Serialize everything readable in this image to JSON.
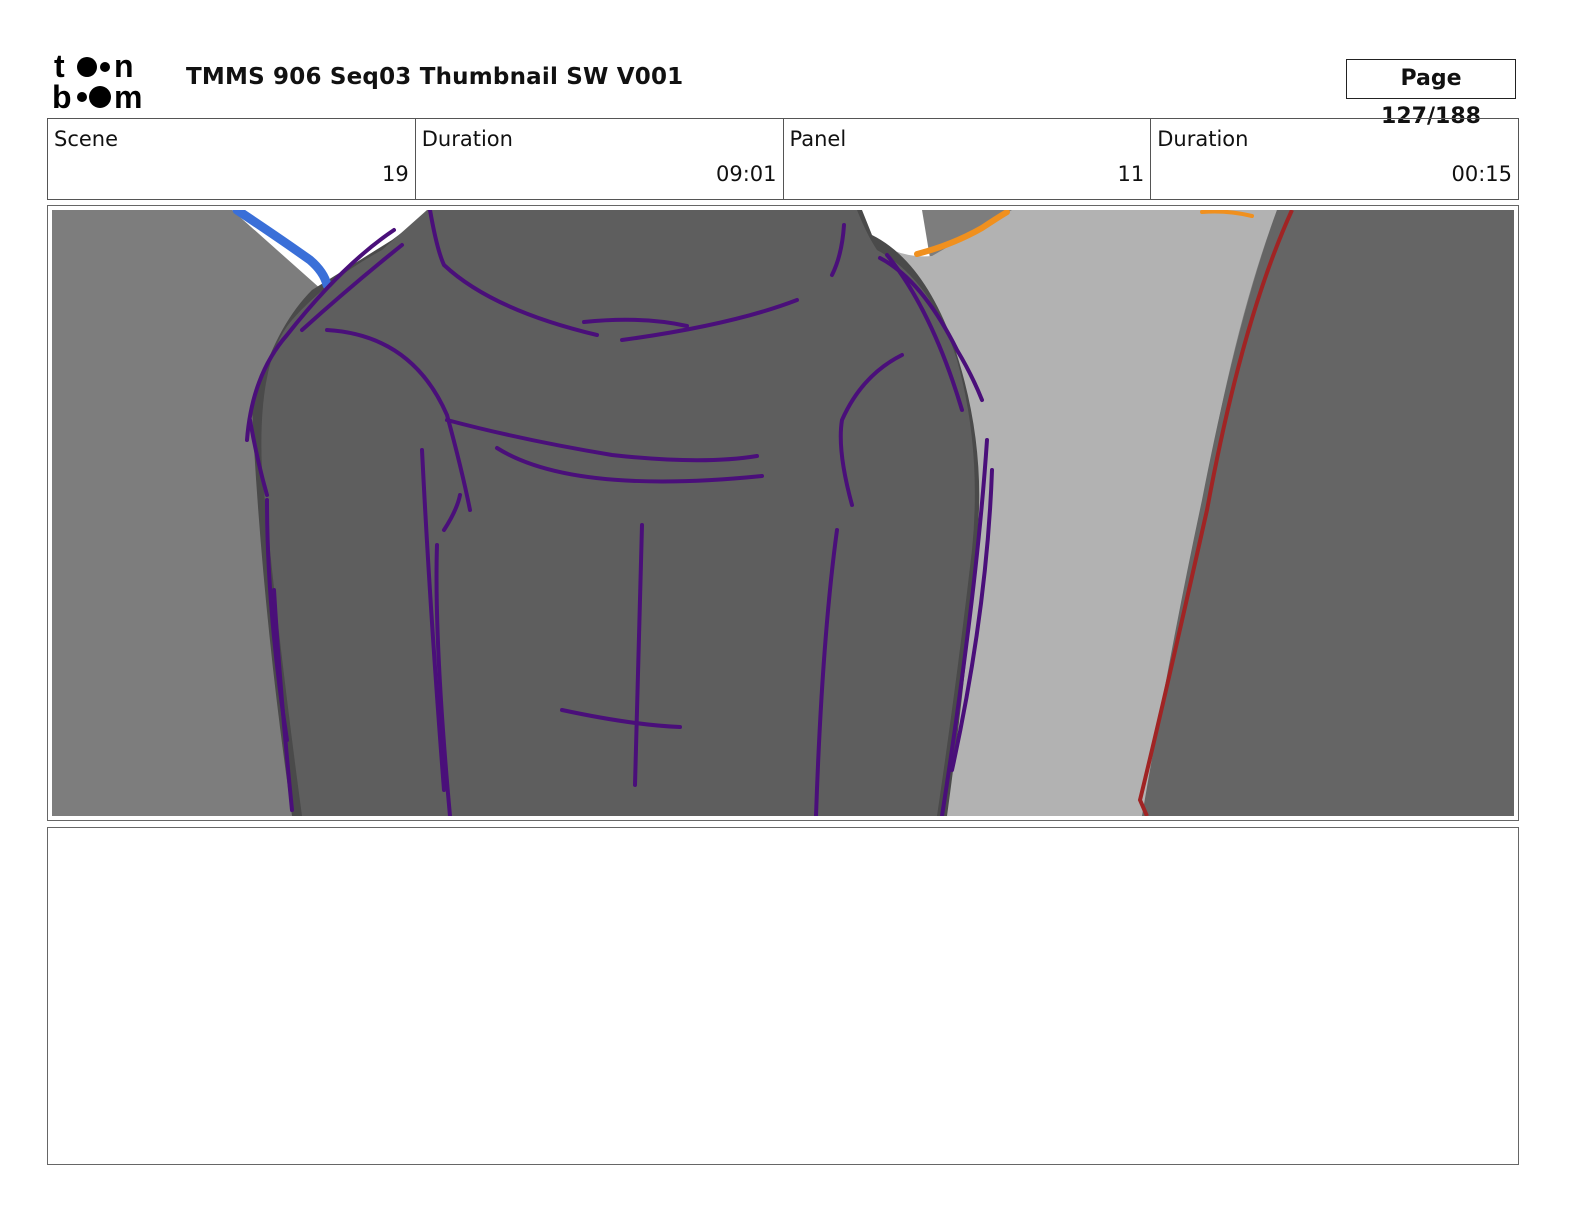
{
  "header": {
    "logo": {
      "brand": "toonboom",
      "line1": "t",
      "line1_end": "n",
      "line2": "b",
      "line2_end": "m"
    },
    "title": "TMMS 906 Seq03 Thumbnail SW V001",
    "page_label": "Page 127/188"
  },
  "info": {
    "scene_label": "Scene",
    "scene_value": "19",
    "scene_duration_label": "Duration",
    "scene_duration_value": "09:01",
    "panel_label": "Panel",
    "panel_value": "11",
    "panel_duration_label": "Duration",
    "panel_duration_value": "00:15"
  },
  "panel": {
    "colors": {
      "left_wall": "#7d7d7d",
      "right_wall": "#656565",
      "center_light": "#b2b2b2",
      "figure": "#5e5e5e",
      "figure_shadow": "#4a4a4a",
      "purple_line": "#4a0f7a",
      "red_line": "#a02424",
      "blue_accent": "#3a6fd8",
      "orange_accent": "#f0901e"
    }
  },
  "notes": {
    "text": ""
  }
}
